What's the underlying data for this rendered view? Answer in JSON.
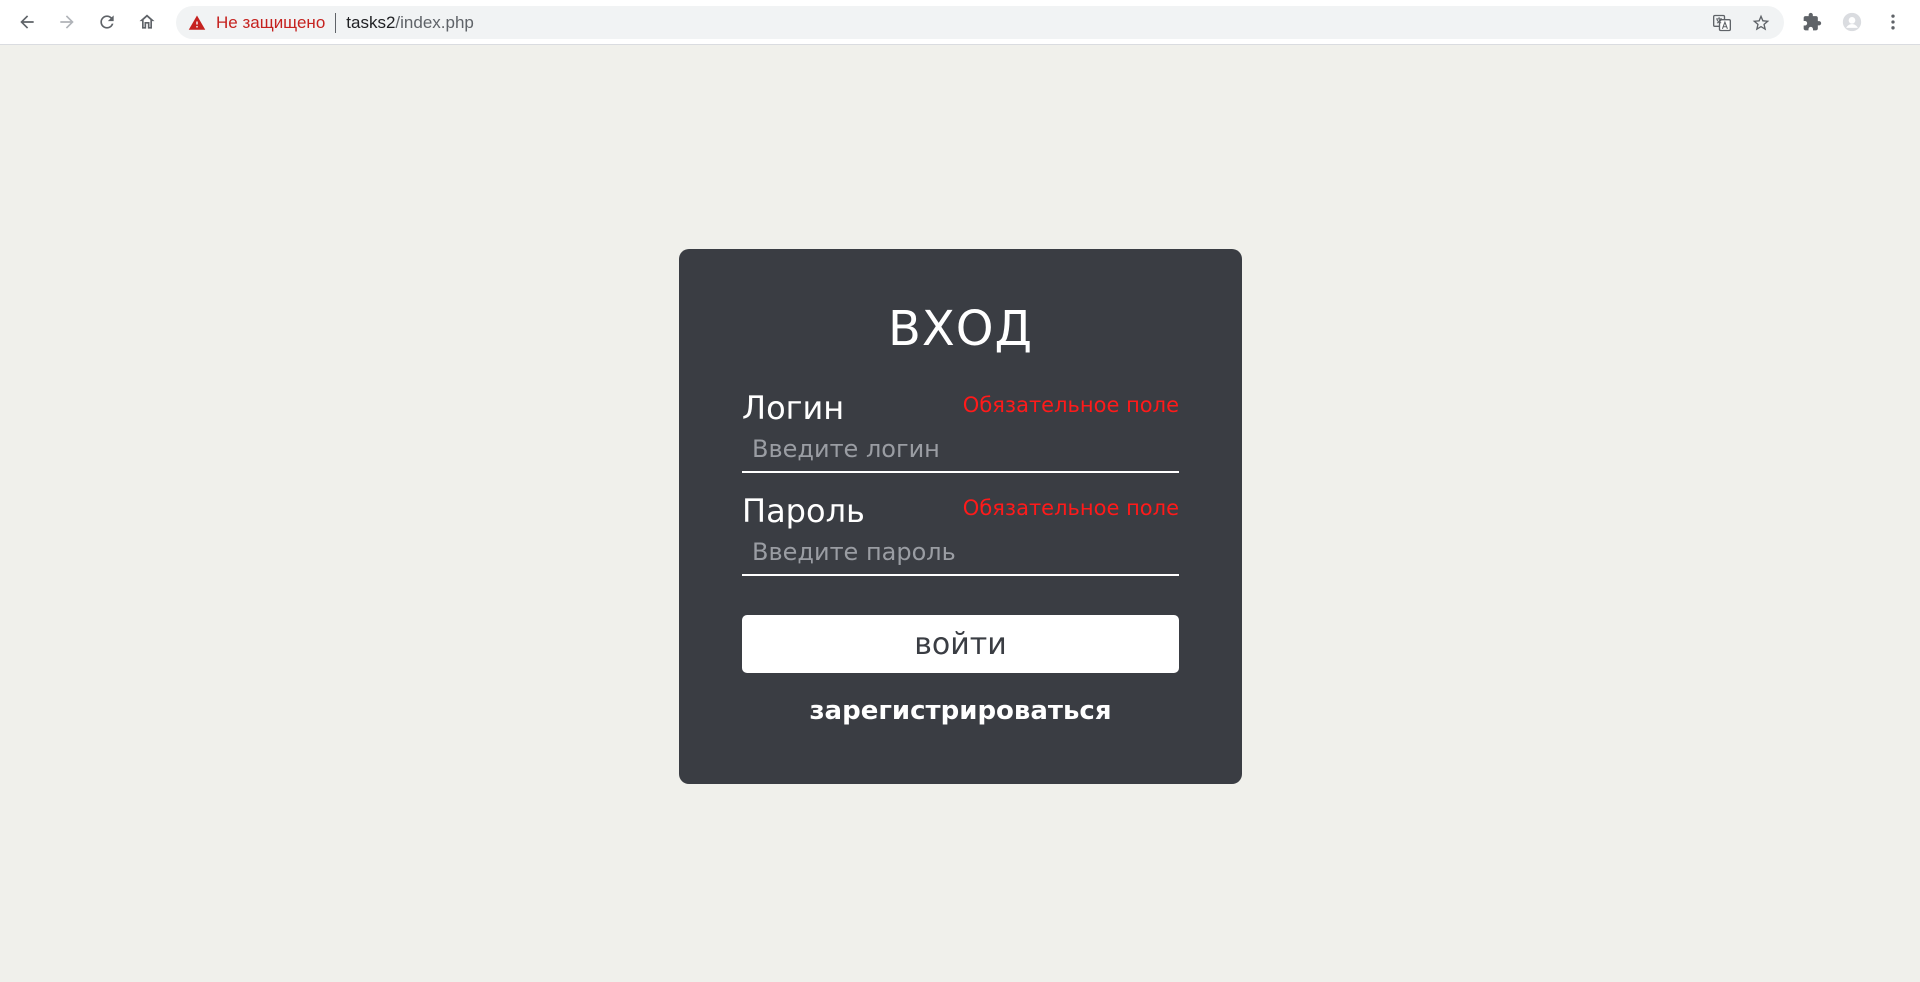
{
  "browser": {
    "security_label": "Не защищено",
    "url_host": "tasks2",
    "url_path": "/index.php",
    "icons": {
      "back": "back-arrow-icon",
      "forward": "forward-arrow-icon",
      "reload": "reload-icon",
      "home": "home-icon",
      "warning": "warning-triangle-icon",
      "translate": "translate-icon",
      "bookmark": "star-icon",
      "extensions": "puzzle-icon",
      "profile": "avatar-icon",
      "menu": "three-dots-vertical-icon"
    },
    "colors": {
      "warning": "#c5221f"
    }
  },
  "login": {
    "title": "ВХОД",
    "login_field": {
      "label": "Логин",
      "error": "Обязательное поле",
      "placeholder": "Введите логин",
      "value": ""
    },
    "password_field": {
      "label": "Пароль",
      "error": "Обязательное поле",
      "placeholder": "Введите пароль",
      "value": ""
    },
    "submit_label": "войти",
    "register_label": "зарегистрироваться",
    "colors": {
      "card": "#3a3d43",
      "page": "#f0f0eb",
      "error": "#ff1a1a",
      "text": "#ffffff"
    }
  }
}
